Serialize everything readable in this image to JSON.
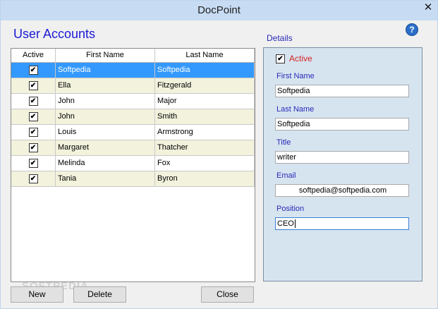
{
  "window": {
    "title": "DocPoint",
    "close_glyph": "✕"
  },
  "header": {
    "title": "User Accounts",
    "details_label": "Details",
    "help_glyph": "?"
  },
  "grid": {
    "columns": [
      "Active",
      "First Name",
      "Last Name"
    ],
    "rows": [
      {
        "active": true,
        "first": "Softpedia",
        "last": "Softpedia"
      },
      {
        "active": true,
        "first": "Ella",
        "last": "Fitzgerald"
      },
      {
        "active": true,
        "first": "John",
        "last": "Major"
      },
      {
        "active": true,
        "first": "John",
        "last": "Smith"
      },
      {
        "active": true,
        "first": "Louis",
        "last": "Armstrong"
      },
      {
        "active": true,
        "first": "Margaret",
        "last": "Thatcher"
      },
      {
        "active": true,
        "first": "Melinda",
        "last": "Fox"
      },
      {
        "active": true,
        "first": "Tania",
        "last": "Byron"
      }
    ],
    "check_glyph": "✔"
  },
  "details": {
    "active_label": "Active",
    "first_name_label": "First Name",
    "first_name": "Softpedia",
    "last_name_label": "Last Name",
    "last_name": "Softpedia",
    "title_label": "Title",
    "title": "writer",
    "email_label": "Email",
    "email": "softpedia@softpedia.com",
    "position_label": "Position",
    "position": "CEO"
  },
  "buttons": {
    "new": "New",
    "delete": "Delete",
    "close": "Close"
  },
  "watermark": "SOFTPEDIA",
  "colors": {
    "selection": "#3399ff",
    "heading": "#1a1ad6",
    "active_label": "#d42222",
    "panel": "#d6e4f0"
  }
}
